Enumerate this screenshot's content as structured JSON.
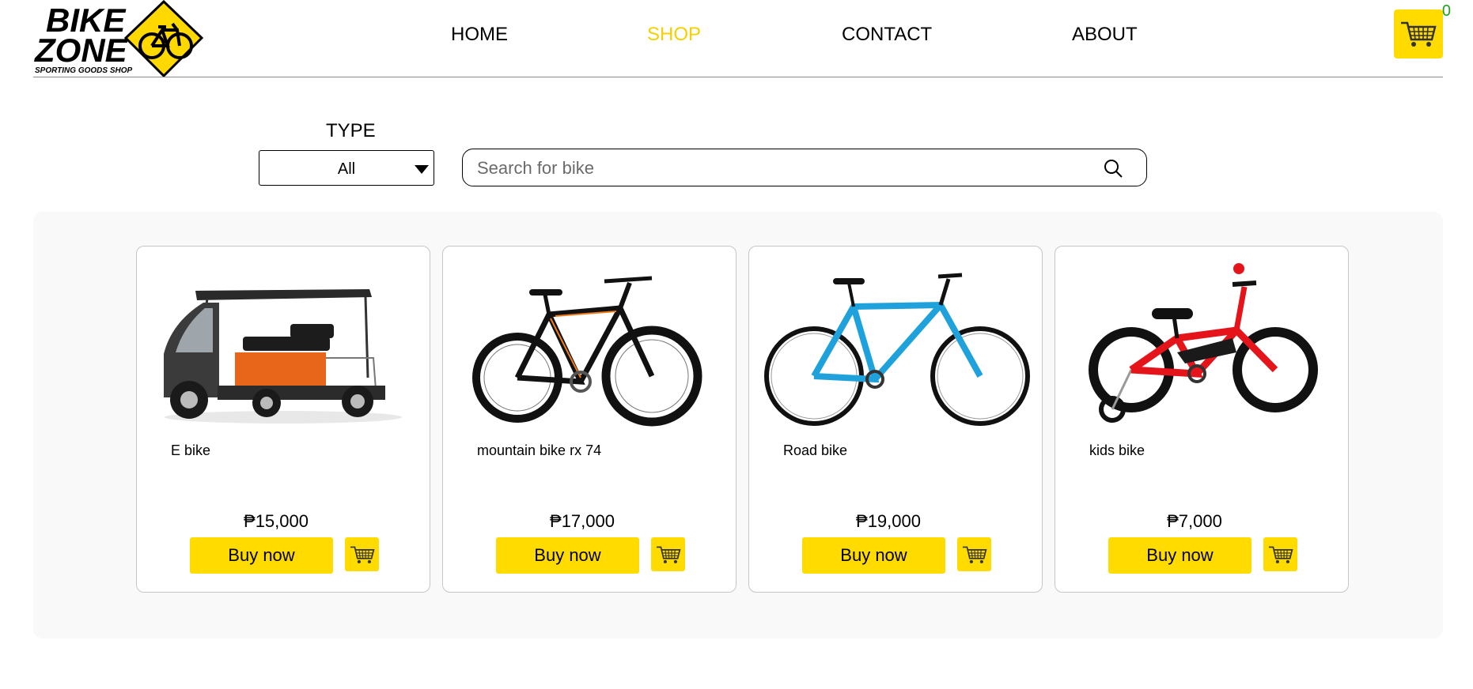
{
  "brand": {
    "logo_line1": "BIKE",
    "logo_line2": "ZONE",
    "logo_tagline": "SPORTING GOODS SHOP",
    "accent_color": "#ffdb00"
  },
  "nav": {
    "items": [
      {
        "label": "HOME",
        "active": false
      },
      {
        "label": "SHOP",
        "active": true
      },
      {
        "label": "CONTACT",
        "active": false
      },
      {
        "label": "ABOUT",
        "active": false
      }
    ],
    "cart_count": "0",
    "cart_icon": "shopping-cart-icon"
  },
  "filters": {
    "type_label": "TYPE",
    "type_selected": "All",
    "search_placeholder": "Search for bike",
    "search_icon": "search-icon"
  },
  "products": [
    {
      "name": "E bike",
      "price": "₱15,000",
      "buy_label": "Buy now",
      "body_color": "#e8661a"
    },
    {
      "name": "mountain bike rx 74",
      "price": "₱17,000",
      "buy_label": "Buy now",
      "body_color": "#ef7a1a"
    },
    {
      "name": "Road bike",
      "price": "₱19,000",
      "buy_label": "Buy now",
      "body_color": "#1fa2dc"
    },
    {
      "name": "kids bike",
      "price": "₱7,000",
      "buy_label": "Buy now",
      "body_color": "#e5141b"
    }
  ]
}
